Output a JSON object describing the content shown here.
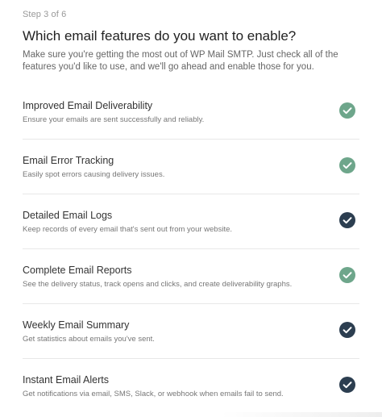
{
  "wizard": {
    "step": "Step 3 of 6",
    "title": "Which email features do you want to enable?",
    "description": "Make sure you're getting the most out of WP Mail SMTP. Just check all of the features you'd like to use, and we'll go ahead and enable those for you."
  },
  "features": [
    {
      "title": "Improved Email Deliverability",
      "description": "Ensure your emails are sent successfully and reliably.",
      "state": "default-enabled",
      "color": "#6ea68b"
    },
    {
      "title": "Email Error Tracking",
      "description": "Easily spot errors causing delivery issues.",
      "state": "default-enabled",
      "color": "#6ea68b"
    },
    {
      "title": "Detailed Email Logs",
      "description": "Keep records of every email that's sent out from your website.",
      "state": "checked",
      "color": "#2c3e50"
    },
    {
      "title": "Complete Email Reports",
      "description": "See the delivery status, track opens and clicks, and create deliverability graphs.",
      "state": "default-enabled",
      "color": "#6ea68b"
    },
    {
      "title": "Weekly Email Summary",
      "description": "Get statistics about emails you've sent.",
      "state": "checked",
      "color": "#2c3e50"
    },
    {
      "title": "Instant Email Alerts",
      "description": "Get notifications via email, SMS, Slack, or webhook when emails fail to send.",
      "state": "checked",
      "color": "#2c3e50"
    }
  ],
  "icons": {
    "check": "check-circle-icon"
  }
}
